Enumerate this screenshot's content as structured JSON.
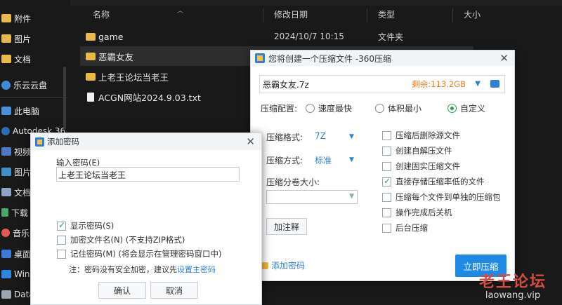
{
  "sidebar": {
    "items": [
      {
        "label": "附件",
        "icon": "folder-icon"
      },
      {
        "label": "图片",
        "icon": "folder-icon"
      },
      {
        "label": "文档",
        "icon": "folder-icon"
      },
      {
        "label": "乐云云盘",
        "icon": "cloud-icon"
      },
      {
        "label": "此电脑",
        "icon": "computer-icon"
      },
      {
        "label": "Autodesk 36",
        "icon": "autodesk-icon"
      },
      {
        "label": "视频",
        "icon": "video-icon"
      },
      {
        "label": "图片",
        "icon": "pictures-icon"
      },
      {
        "label": "文档",
        "icon": "documents-icon"
      },
      {
        "label": "下载",
        "icon": "download-icon"
      },
      {
        "label": "音乐",
        "icon": "music-icon"
      },
      {
        "label": "桌面",
        "icon": "desktop-icon"
      },
      {
        "label": "Wind",
        "icon": "windows-drive-icon"
      },
      {
        "label": "Data",
        "icon": "data-drive-icon"
      }
    ]
  },
  "filelist": {
    "columns": [
      "名称",
      "修改日期",
      "类型",
      "大小"
    ],
    "rows": [
      {
        "name": "game",
        "date": "2024/10/7 10:15",
        "type": "文件夹",
        "icon": "folder-icon"
      },
      {
        "name": "恶霸女友",
        "date": "",
        "type": "",
        "icon": "folder-icon"
      },
      {
        "name": "上老王论坛当老王",
        "date": "",
        "type": "",
        "icon": "folder-icon"
      },
      {
        "name": "ACGN网站2024.9.03.txt",
        "date": "",
        "type": "",
        "icon": "text-file-icon"
      }
    ]
  },
  "zip_dialog": {
    "title": "您将创建一个压缩文件 -360压缩",
    "filename": "恶霸女友.7z",
    "remaining": "剩余:113.2GB",
    "config_label": "压缩配置:",
    "options": [
      "速度最快",
      "体积最小",
      "自定义"
    ],
    "selected_option": "自定义",
    "format_label": "压缩格式:",
    "format_value": "7Z",
    "method_label": "压缩方式:",
    "method_value": "标准",
    "volume_label": "压缩分卷大小:",
    "volume_value": "",
    "note_button": "加注释",
    "checkboxes": [
      {
        "label": "压缩后删除源文件",
        "checked": false
      },
      {
        "label": "创建自解压文件",
        "checked": false
      },
      {
        "label": "创建固实压缩文件",
        "checked": false
      },
      {
        "label": "直接存储压缩率低的文件",
        "checked": true
      },
      {
        "label": "压缩每个文件到单独的压缩包",
        "checked": false
      },
      {
        "label": "操作完成后关机",
        "checked": false
      },
      {
        "label": "后台压缩",
        "checked": false
      }
    ],
    "add_password": "添加密码",
    "start_button": "立即压缩"
  },
  "password_dialog": {
    "title": "添加密码",
    "input_label": "输入密码(E)",
    "password_value": "上老王论坛当老王",
    "checkboxes": [
      {
        "label": "显示密码(S)",
        "checked": true
      },
      {
        "label": "加密文件名(N) (不支持ZIP格式)",
        "checked": false
      },
      {
        "label": "记住密码(M) (将会显示在管理密码窗口中)",
        "checked": false
      }
    ],
    "note_prefix": "注：密码没有安全加密，建议先",
    "note_link": "设置主密码",
    "ok_button": "确认",
    "cancel_button": "取消"
  },
  "watermark": {
    "title": "老王论坛",
    "url": "laowang.vip"
  },
  "colors": {
    "accent_blue": "#1f8ae6",
    "remaining_orange": "#f07d1a",
    "check_green": "#2aa34a",
    "watermark_red": "#d24c44"
  }
}
